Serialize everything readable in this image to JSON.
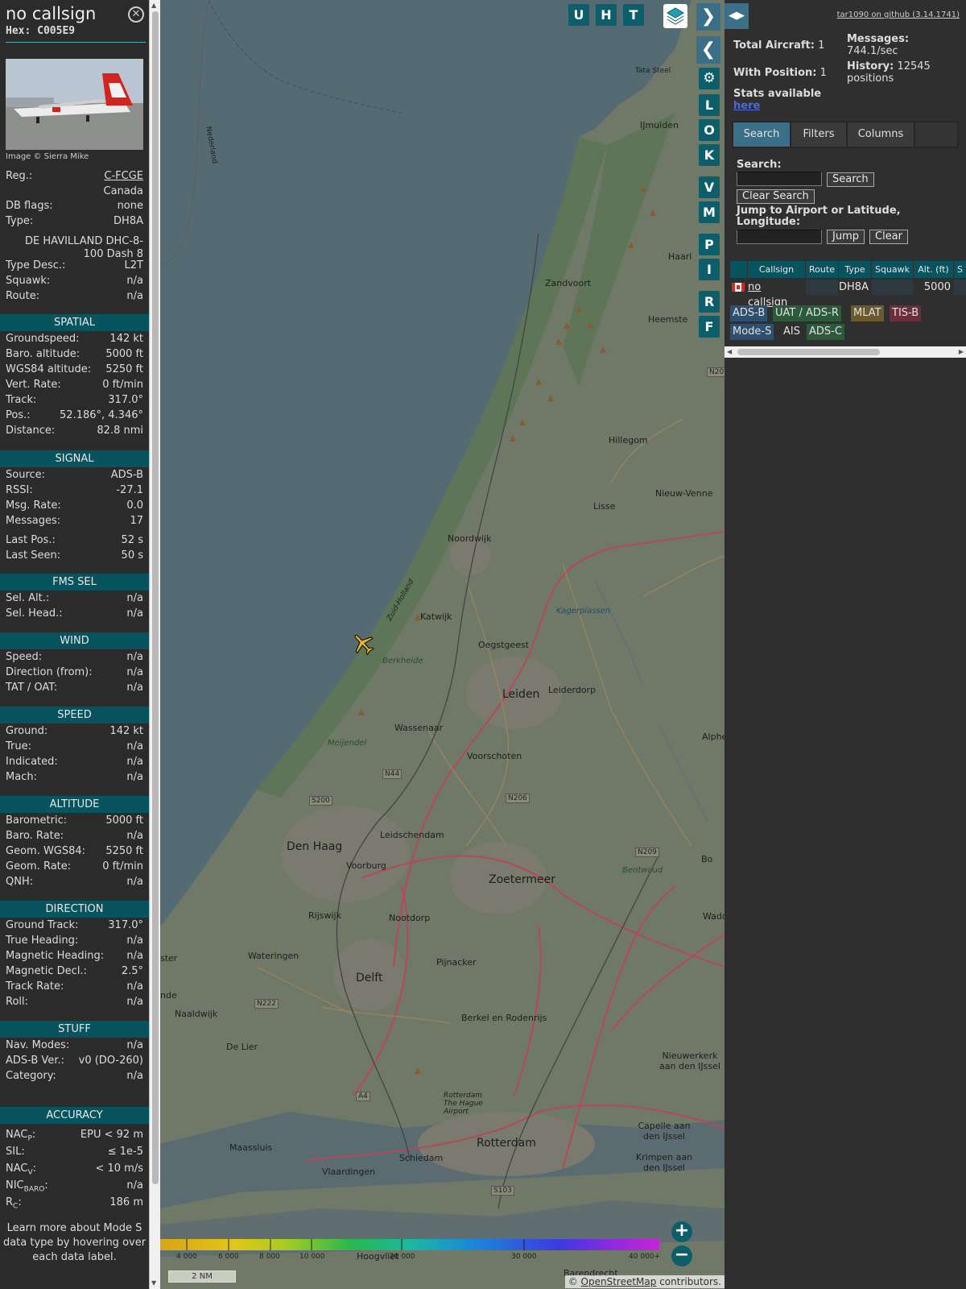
{
  "header": {
    "callsign": "no callsign",
    "hex": "Hex: C005E9",
    "close_icon": "close-icon"
  },
  "photo": {
    "caption": "Image © Sierra Mike"
  },
  "aircraft": [
    {
      "label": "Reg.:",
      "value": "C-FCGE",
      "link": true
    },
    {
      "label": "",
      "value": "Canada"
    },
    {
      "label": "DB flags:",
      "value": "none"
    },
    {
      "label": "Type:",
      "value": "DH8A"
    }
  ],
  "type_name": "DE HAVILLAND DHC-8-100 Dash 8",
  "aircraft2": [
    {
      "label": "Type Desc.:",
      "value": "L2T"
    },
    {
      "label": "Squawk:",
      "value": "n/a"
    },
    {
      "label": "Route:",
      "value": "n/a"
    }
  ],
  "sections": {
    "spatial": {
      "title": "SPATIAL",
      "rows": [
        {
          "label": "Groundspeed:",
          "value": "142 kt"
        },
        {
          "label": "Baro. altitude:",
          "value": "5000 ft"
        },
        {
          "label": "WGS84 altitude:",
          "value": "5250 ft"
        },
        {
          "label": "Vert. Rate:",
          "value": "0 ft/min"
        },
        {
          "label": "Track:",
          "value": "317.0°"
        },
        {
          "label": "Pos.:",
          "value": "52.186°, 4.346°"
        },
        {
          "label": "Distance:",
          "value": "82.8 nmi"
        }
      ]
    },
    "signal": {
      "title": "SIGNAL",
      "rows": [
        {
          "label": "Source:",
          "value": "ADS-B"
        },
        {
          "label": "RSSI:",
          "value": "-27.1"
        },
        {
          "label": "Msg. Rate:",
          "value": "0.0"
        },
        {
          "label": "Messages:",
          "value": "17"
        },
        {
          "label": "Last Pos.:",
          "value": "52 s"
        },
        {
          "label": "Last Seen:",
          "value": "50 s"
        }
      ]
    },
    "fms": {
      "title": "FMS SEL",
      "rows": [
        {
          "label": "Sel. Alt.:",
          "value": "n/a"
        },
        {
          "label": "Sel. Head.:",
          "value": "n/a"
        }
      ]
    },
    "wind": {
      "title": "WIND",
      "rows": [
        {
          "label": "Speed:",
          "value": "n/a"
        },
        {
          "label": "Direction (from):",
          "value": "n/a"
        },
        {
          "label": "TAT / OAT:",
          "value": "n/a"
        }
      ]
    },
    "speed": {
      "title": "SPEED",
      "rows": [
        {
          "label": "Ground:",
          "value": "142 kt"
        },
        {
          "label": "True:",
          "value": "n/a"
        },
        {
          "label": "Indicated:",
          "value": "n/a"
        },
        {
          "label": "Mach:",
          "value": "n/a"
        }
      ]
    },
    "altitude": {
      "title": "ALTITUDE",
      "rows": [
        {
          "label": "Barometric:",
          "value": "5000 ft"
        },
        {
          "label": "Baro. Rate:",
          "value": "n/a"
        },
        {
          "label": "Geom. WGS84:",
          "value": "5250 ft"
        },
        {
          "label": "Geom. Rate:",
          "value": "0 ft/min"
        },
        {
          "label": "QNH:",
          "value": "n/a"
        }
      ]
    },
    "direction": {
      "title": "DIRECTION",
      "rows": [
        {
          "label": "Ground Track:",
          "value": "317.0°"
        },
        {
          "label": "True Heading:",
          "value": "n/a"
        },
        {
          "label": "Magnetic Heading:",
          "value": "n/a"
        },
        {
          "label": "Magnetic Decl.:",
          "value": "2.5°"
        },
        {
          "label": "Track Rate:",
          "value": "n/a"
        },
        {
          "label": "Roll:",
          "value": "n/a"
        }
      ]
    },
    "stuff": {
      "title": "STUFF",
      "rows": [
        {
          "label": "Nav. Modes:",
          "value": "n/a"
        },
        {
          "label": "ADS-B Ver.:",
          "value": "v0 (DO-260)"
        },
        {
          "label": "Category:",
          "value": "n/a"
        }
      ]
    },
    "accuracy": {
      "title": "ACCURACY",
      "rows": [
        {
          "label": "NAC",
          "sub": "P",
          "label_end": ":",
          "value": "EPU < 92 m"
        },
        {
          "label": "SIL:",
          "sub": "",
          "label_end": "",
          "value": "≤ 1e-5"
        },
        {
          "label": "NAC",
          "sub": "V",
          "label_end": ":",
          "value": "< 10 m/s"
        },
        {
          "label": "NIC",
          "sub": "BARO",
          "label_end": ":",
          "value": "n/a"
        },
        {
          "label": "R",
          "sub": "C",
          "label_end": ":",
          "value": "186 m"
        }
      ]
    }
  },
  "footnote": "Learn more about Mode S data type by hovering over each data label.",
  "map": {
    "towns": [
      "Zandvoort",
      "Heemste",
      "Hillegom",
      "Nieuw-Venne",
      "Lisse",
      "Noordwijk",
      "Katwijk",
      "Oegstgeest",
      "Leiden",
      "Leiderdorp",
      "Wassenaar",
      "Voorschoten",
      "Alphe den",
      "Leidschendam",
      "Den Haag",
      "Voorburg",
      "Zoetermeer",
      "Rijswijk",
      "Nootdorp",
      "Wateringen",
      "Delft",
      "Pijnacker",
      "Naaldwijk",
      "De Lier",
      "Berkel en Rodenrijs",
      "Maassluis",
      "Schiedam",
      "Vlaardingen",
      "Rotterdam",
      "Capelle aan den IJssel",
      "Krimpen aan den IJssel",
      "Nieuwerkerk aan den IJssel",
      "Haarl",
      "IJmuiden",
      "Tata Steel",
      "Kagerplassen",
      "Berkheide",
      "Meijendel",
      "Bentwoud",
      "Waddin",
      "Barendrecht",
      "Hoogvliet",
      "ster",
      "nde",
      "Bo",
      "Zuid-Holland",
      "Nederland",
      "Rotterdam The Hague Airport"
    ],
    "road_tags": [
      "N44",
      "S200",
      "N206",
      "N209",
      "N222",
      "A4",
      "S103",
      "N20"
    ],
    "tools": [
      "U",
      "H",
      "T",
      "L",
      "O",
      "K",
      "V",
      "M",
      "P",
      "I",
      "R",
      "F"
    ],
    "altitude_scale": [
      "4 000",
      "6 000",
      "8 000",
      "10 000",
      "20 000",
      "30 000",
      "40 000+"
    ],
    "scale": "2 NM",
    "attribution_prefix": "©",
    "attribution_link": "OpenStreetMap",
    "attribution_suffix": "contributors."
  },
  "sidebar": {
    "github": "tar1090 on github (3.14.1741)",
    "total_aircraft_label": "Total Aircraft:",
    "total_aircraft": "1",
    "with_position_label": "With Position:",
    "with_position": "1",
    "messages_label": "Messages:",
    "messages": "744.1/sec",
    "history_label": "History:",
    "history": "12545 positions",
    "stats_label": "Stats available",
    "stats_link": "here",
    "tabs": [
      "Search",
      "Filters",
      "Columns"
    ],
    "search_label": "Search:",
    "search_value": "",
    "search_button": "Search",
    "clear_search_button": "Clear Search",
    "jump_label": "Jump to Airport or Latitude, Longitude:",
    "jump_value": "",
    "jump_button": "Jump",
    "clear_button": "Clear",
    "table_headers": [
      "Callsign",
      "Route",
      "Type",
      "Squawk",
      "Alt. (ft)",
      "S"
    ],
    "table_row": {
      "callsign": "no callsign",
      "route": "",
      "type": "DH8A",
      "squawk": "",
      "alt": "5000"
    },
    "sources": [
      {
        "label": "ADS-B",
        "color": "#2e4f6e"
      },
      {
        "label": "UAT / ADS-R",
        "color": "#2d5a3a"
      },
      {
        "label": "MLAT",
        "color": "#6b5a2e"
      },
      {
        "label": "TIS-B",
        "color": "#6b2e3a"
      },
      {
        "label": "Mode-S",
        "color": "#2e4f6e"
      },
      {
        "label": "AIS",
        "color": "#2f2f2f"
      },
      {
        "label": "ADS-C",
        "color": "#2d5a3a"
      }
    ]
  }
}
